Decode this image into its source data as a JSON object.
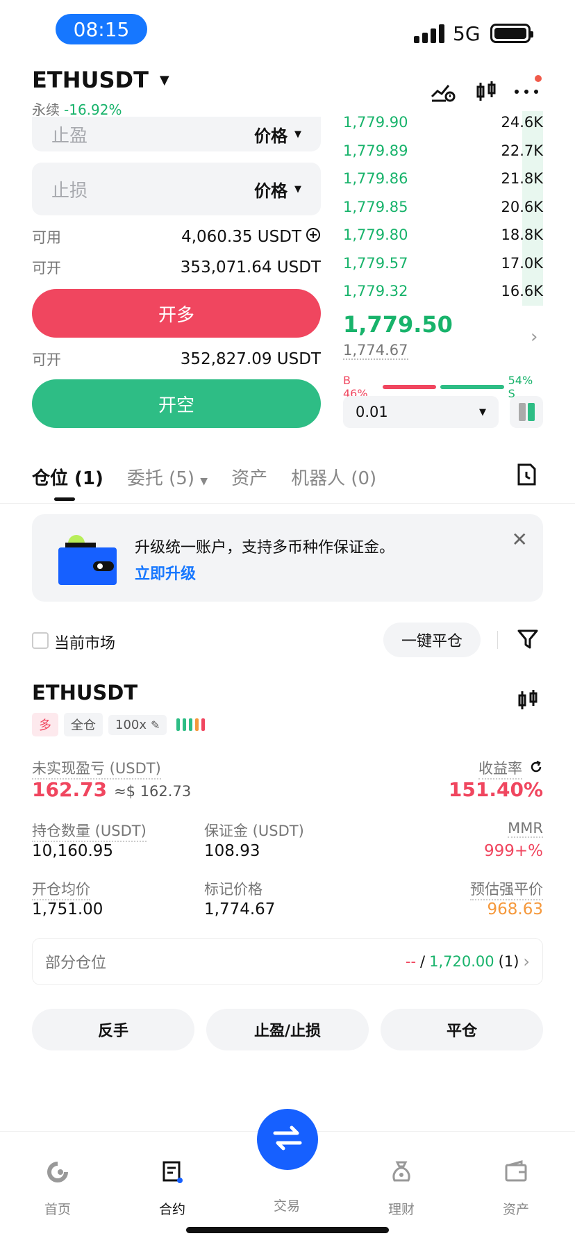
{
  "status_bar": {
    "time": "08:15",
    "network": "5G"
  },
  "header": {
    "symbol": "ETHUSDT",
    "type": "永续",
    "change": "-16.92%"
  },
  "order_form": {
    "take_profit_placeholder": "止盈",
    "stop_loss_placeholder": "止损",
    "price_type": "价格",
    "available_label": "可用",
    "available_value": "4,060.35 USDT",
    "can_open_label": "可开",
    "can_open_long_value": "353,071.64 USDT",
    "long_button": "开多",
    "can_open_short_value": "352,827.09 USDT",
    "short_button": "开空"
  },
  "order_book": {
    "rows": [
      {
        "price": "1,779.90",
        "qty": "24.6K"
      },
      {
        "price": "1,779.89",
        "qty": "22.7K"
      },
      {
        "price": "1,779.86",
        "qty": "21.8K"
      },
      {
        "price": "1,779.85",
        "qty": "20.6K"
      },
      {
        "price": "1,779.80",
        "qty": "18.8K"
      },
      {
        "price": "1,779.57",
        "qty": "17.0K"
      },
      {
        "price": "1,779.32",
        "qty": "16.6K"
      }
    ],
    "last_price": "1,779.50",
    "mark_price": "1,774.67",
    "buy_ratio": "B 46%",
    "sell_ratio": "54% S",
    "buy_ratio_value": 46,
    "depth": "0.01"
  },
  "tabs": [
    {
      "label": "仓位 (1)"
    },
    {
      "label": "委托 (5)"
    },
    {
      "label": "资产"
    },
    {
      "label": "机器人 (0)"
    }
  ],
  "banner": {
    "text": "升级统一账户，支持多币种作保证金。",
    "link": "立即升级"
  },
  "filter": {
    "current_market": "当前市场",
    "close_all": "一键平仓"
  },
  "position": {
    "symbol": "ETHUSDT",
    "side": "多",
    "margin_mode": "全仓",
    "leverage": "100x",
    "unrealized_label": "未实现盈亏 (USDT)",
    "unrealized_value": "162.73",
    "unrealized_usd": "≈$ 162.73",
    "roe_label": "收益率",
    "roe_value": "151.40%",
    "size_label": "持仓数量 (USDT)",
    "size_value": "10,160.95",
    "margin_label": "保证金 (USDT)",
    "margin_value": "108.93",
    "mmr_label": "MMR",
    "mmr_value": "999+%",
    "entry_label": "开仓均价",
    "entry_value": "1,751.00",
    "mark_label": "标记价格",
    "mark_value": "1,774.67",
    "liq_label": "预估强平价",
    "liq_value": "968.63",
    "partial_label": "部分仓位",
    "partial_tp": "--",
    "partial_slash": "/",
    "partial_sl": "1,720.00",
    "partial_count": "(1)",
    "btn_reverse": "反手",
    "btn_tpsl": "止盈/止损",
    "btn_close": "平仓"
  },
  "bottom_nav": [
    {
      "label": "首页"
    },
    {
      "label": "合约"
    },
    {
      "label": "交易"
    },
    {
      "label": "理财"
    },
    {
      "label": "资产"
    }
  ],
  "colors": {
    "accent": "#1677ff",
    "long": "#f0465f",
    "short": "#2ebd85",
    "up": "#18b36b",
    "warn": "#f5983b"
  }
}
